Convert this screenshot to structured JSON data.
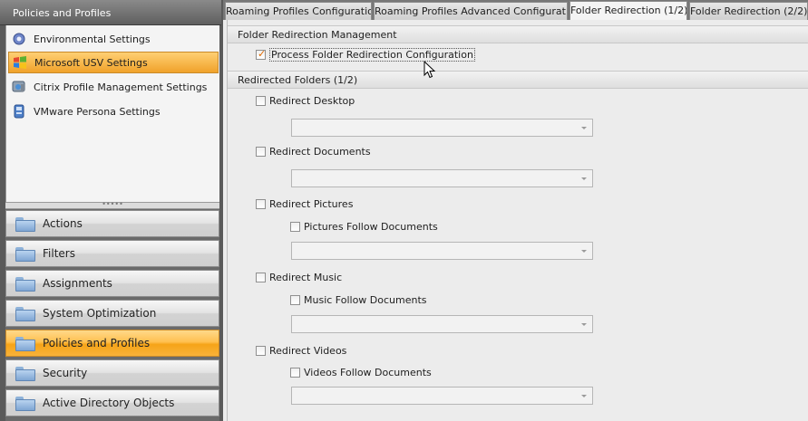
{
  "left_panel": {
    "header": "Policies and Profiles",
    "items": [
      {
        "label": "Environmental Settings",
        "icon": "gear-icon"
      },
      {
        "label": "Microsoft USV Settings",
        "icon": "windows-icon",
        "selected": true
      },
      {
        "label": "Citrix Profile Management Settings",
        "icon": "citrix-icon"
      },
      {
        "label": "VMware Persona Settings",
        "icon": "vmware-icon"
      }
    ],
    "splitter_grip": "•••••",
    "nav": [
      {
        "label": "Actions"
      },
      {
        "label": "Filters"
      },
      {
        "label": "Assignments"
      },
      {
        "label": "System Optimization"
      },
      {
        "label": "Policies and Profiles",
        "selected": true
      },
      {
        "label": "Security"
      },
      {
        "label": "Active Directory Objects"
      }
    ]
  },
  "tabs": [
    {
      "label": "Roaming Profiles Configuration"
    },
    {
      "label": "Roaming Profiles Advanced Configuration"
    },
    {
      "label": "Folder Redirection (1/2)",
      "active": true
    },
    {
      "label": "Folder Redirection (2/2)"
    }
  ],
  "content": {
    "section_management": "Folder Redirection Management",
    "process_checkbox": {
      "label": "Process Folder Redirection Configuration",
      "checked": true
    },
    "section_folders": "Redirected Folders (1/2)",
    "desktop": {
      "label": "Redirect Desktop",
      "checked": false,
      "path": ""
    },
    "documents": {
      "label": "Redirect Documents",
      "checked": false,
      "path": ""
    },
    "pictures": {
      "label": "Redirect Pictures",
      "checked": false,
      "follow_label": "Pictures Follow Documents",
      "follow_checked": false,
      "path": ""
    },
    "music": {
      "label": "Redirect Music",
      "checked": false,
      "follow_label": "Music Follow Documents",
      "follow_checked": false,
      "path": ""
    },
    "videos": {
      "label": "Redirect Videos",
      "checked": false,
      "follow_label": "Videos Follow Documents",
      "follow_checked": false,
      "path": ""
    }
  },
  "colors": {
    "selected_orange": "#f6a418",
    "check_mark": "#e06a00"
  }
}
